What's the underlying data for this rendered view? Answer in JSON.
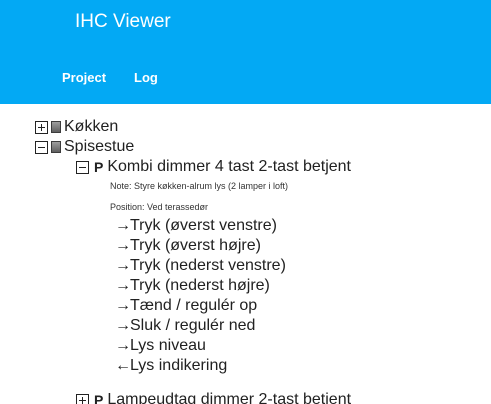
{
  "header": {
    "title": "IHC Viewer",
    "tabs": [
      {
        "label": "Project"
      },
      {
        "label": "Log"
      }
    ]
  },
  "tree": {
    "groups": [
      {
        "name": "Køkken",
        "expanded": false
      },
      {
        "name": "Spisestue",
        "expanded": true
      }
    ],
    "products": [
      {
        "mark": "P",
        "name": "Kombi dimmer 4 tast 2-tast betjent",
        "expanded": true,
        "note": "Note: Styre køkken-alrum lys (2 lamper i loft)",
        "position": "Position: Ved terassedør",
        "io": [
          {
            "arrow": "→",
            "label": "Tryk (øverst venstre)"
          },
          {
            "arrow": "→",
            "label": "Tryk (øverst højre)"
          },
          {
            "arrow": "→",
            "label": "Tryk (nederst venstre)"
          },
          {
            "arrow": "→",
            "label": "Tryk (nederst højre)"
          },
          {
            "arrow": "→",
            "label": "Tænd / regulér op"
          },
          {
            "arrow": "→",
            "label": "Sluk / regulér ned"
          },
          {
            "arrow": "→",
            "label": "Lys niveau"
          },
          {
            "arrow": "←",
            "label": "Lys indikering"
          }
        ]
      },
      {
        "mark": "P",
        "name": "Lampeudtag dimmer 2-tast betjent",
        "expanded": false
      }
    ]
  }
}
